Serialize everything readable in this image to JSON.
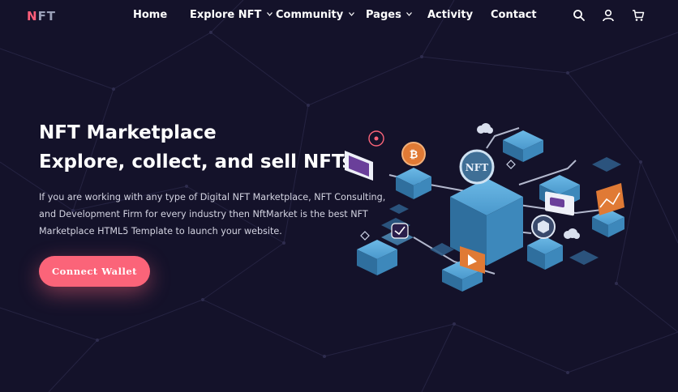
{
  "header": {
    "logo": {
      "accent": "N",
      "rest": "FT"
    },
    "nav": [
      {
        "label": "Home",
        "dropdown": false
      },
      {
        "label": "Explore NFT",
        "dropdown": true
      },
      {
        "label": "Community",
        "dropdown": true
      },
      {
        "label": "Pages",
        "dropdown": true
      },
      {
        "label": "Activity",
        "dropdown": false
      },
      {
        "label": "Contact",
        "dropdown": false
      }
    ],
    "icons": [
      "search-icon",
      "user-icon",
      "cart-icon"
    ]
  },
  "hero": {
    "title_line1": "NFT Marketplace",
    "title_line2": "Explore, collect, and sell NFTs",
    "description": "If you are working with any type of Digital NFT Marketplace, NFT Consulting, and Development Firm for every industry then NftMarket is the best NFT Marketplace HTML5 Template to launch your website.",
    "cta_label": "Connect Wallet",
    "illustration_label": "NFT"
  },
  "colors": {
    "background": "#14122a",
    "accent": "#fb6479",
    "cube": "#3b86b8",
    "cube_light": "#5aa6d6"
  }
}
